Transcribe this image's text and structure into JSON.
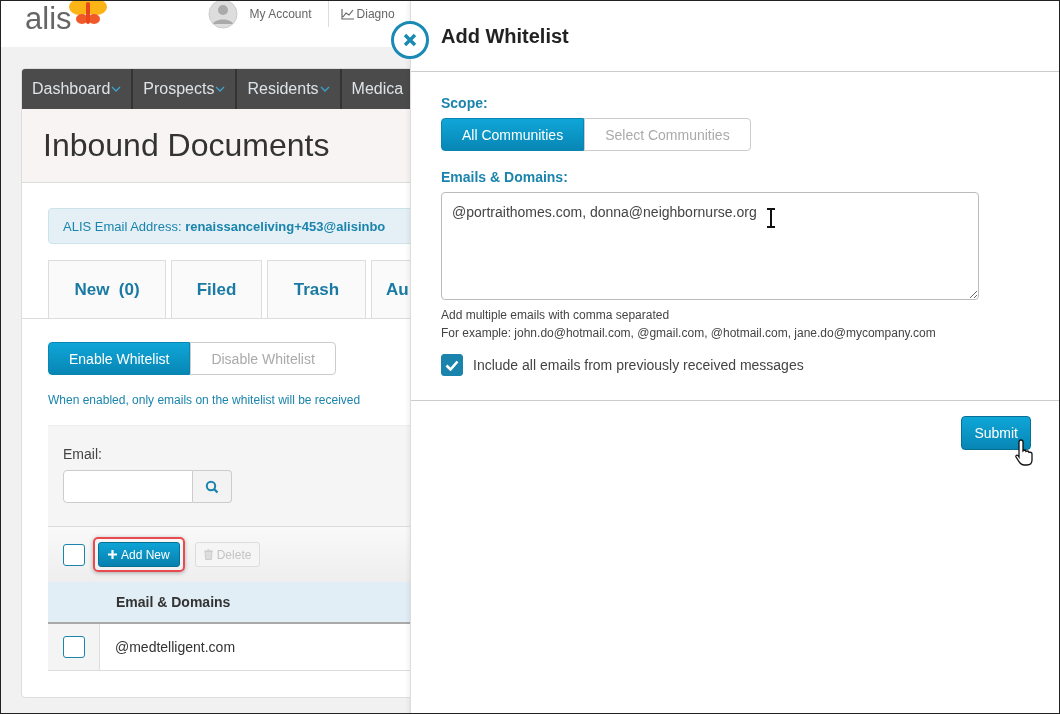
{
  "header": {
    "logo": "alis",
    "account": "My Account",
    "diagnostics": "Diagno"
  },
  "nav": [
    {
      "label": "Dashboard",
      "dropdown": true
    },
    {
      "label": "Prospects",
      "dropdown": true
    },
    {
      "label": "Residents",
      "dropdown": true
    },
    {
      "label": "Medica",
      "dropdown": false
    }
  ],
  "page_title": "Inbound Documents",
  "email_address": {
    "label": "ALIS Email Address:",
    "value": "renaissanceliving+453@alisinbo"
  },
  "tabs": [
    {
      "label": "New  (0)"
    },
    {
      "label": "Filed"
    },
    {
      "label": "Trash"
    },
    {
      "label": "Au"
    }
  ],
  "whitelist_toggle": [
    {
      "label": "Enable Whitelist",
      "selected": true
    },
    {
      "label": "Disable Whitelist",
      "selected": false
    }
  ],
  "whitelist_note": "When enabled, only emails on the whitelist will be received",
  "filter": {
    "label": "Email:"
  },
  "toolbar": {
    "select_all_checked": false,
    "add_new": "Add New",
    "add_new_highlighted": true,
    "delete": "Delete",
    "delete_disabled": true
  },
  "table": {
    "columns": [
      "Email & Domains"
    ],
    "rows": [
      {
        "email": "@medtelligent.com",
        "checked": false
      }
    ]
  },
  "drawer": {
    "title": "Add Whitelist",
    "scope_label": "Scope:",
    "scope": [
      {
        "label": "All Communities",
        "selected": true
      },
      {
        "label": "Select Communities",
        "selected": false
      }
    ],
    "emails_label": "Emails & Domains:",
    "emails_value": "@portraithomes.com, donna@neighbornurse.org",
    "hints": [
      "Add multiple emails with comma separated",
      "For example: john.do@hotmail.com, @gmail.com, @hotmail.com, jane.do@mycompany.com"
    ],
    "include_previous": {
      "label": "Include all emails from previously received messages",
      "checked": true
    },
    "submit": "Submit"
  }
}
